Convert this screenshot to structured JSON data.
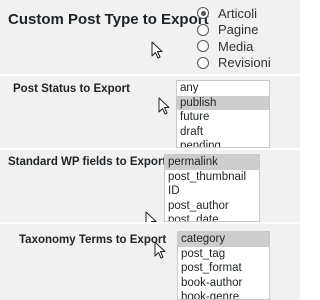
{
  "post_type": {
    "label": "Custom Post Type to Export",
    "options": [
      {
        "label": "Articoli",
        "checked": true
      },
      {
        "label": "Pagine",
        "checked": false
      },
      {
        "label": "Media",
        "checked": false
      },
      {
        "label": "Revisioni",
        "checked": false
      }
    ]
  },
  "post_status": {
    "label": "Post Status to Export",
    "options": [
      "any",
      "publish",
      "future",
      "draft",
      "pending"
    ],
    "selected": "publish"
  },
  "wp_fields": {
    "label": "Standard WP fields to Export",
    "options": [
      "permalink",
      "post_thumbnail",
      "ID",
      "post_author",
      "post_date"
    ],
    "selected": "permalink"
  },
  "taxonomy": {
    "label": "Taxonomy Terms to Export",
    "options": [
      "category",
      "post_tag",
      "post_format",
      "book-author",
      "book-genre"
    ],
    "selected": "category"
  }
}
